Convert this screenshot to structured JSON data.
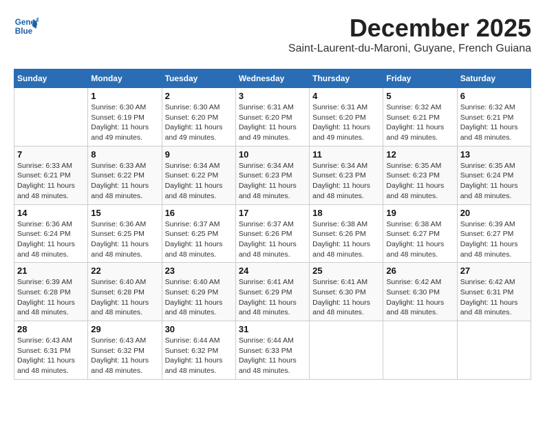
{
  "header": {
    "logo_line1": "General",
    "logo_line2": "Blue",
    "month_title": "December 2025",
    "location": "Saint-Laurent-du-Maroni, Guyane, French Guiana"
  },
  "weekdays": [
    "Sunday",
    "Monday",
    "Tuesday",
    "Wednesday",
    "Thursday",
    "Friday",
    "Saturday"
  ],
  "weeks": [
    [
      {
        "day": "",
        "sunrise": "",
        "sunset": "",
        "daylight": ""
      },
      {
        "day": "1",
        "sunrise": "Sunrise: 6:30 AM",
        "sunset": "Sunset: 6:19 PM",
        "daylight": "Daylight: 11 hours and 49 minutes."
      },
      {
        "day": "2",
        "sunrise": "Sunrise: 6:30 AM",
        "sunset": "Sunset: 6:20 PM",
        "daylight": "Daylight: 11 hours and 49 minutes."
      },
      {
        "day": "3",
        "sunrise": "Sunrise: 6:31 AM",
        "sunset": "Sunset: 6:20 PM",
        "daylight": "Daylight: 11 hours and 49 minutes."
      },
      {
        "day": "4",
        "sunrise": "Sunrise: 6:31 AM",
        "sunset": "Sunset: 6:20 PM",
        "daylight": "Daylight: 11 hours and 49 minutes."
      },
      {
        "day": "5",
        "sunrise": "Sunrise: 6:32 AM",
        "sunset": "Sunset: 6:21 PM",
        "daylight": "Daylight: 11 hours and 49 minutes."
      },
      {
        "day": "6",
        "sunrise": "Sunrise: 6:32 AM",
        "sunset": "Sunset: 6:21 PM",
        "daylight": "Daylight: 11 hours and 48 minutes."
      }
    ],
    [
      {
        "day": "7",
        "sunrise": "Sunrise: 6:33 AM",
        "sunset": "Sunset: 6:21 PM",
        "daylight": "Daylight: 11 hours and 48 minutes."
      },
      {
        "day": "8",
        "sunrise": "Sunrise: 6:33 AM",
        "sunset": "Sunset: 6:22 PM",
        "daylight": "Daylight: 11 hours and 48 minutes."
      },
      {
        "day": "9",
        "sunrise": "Sunrise: 6:34 AM",
        "sunset": "Sunset: 6:22 PM",
        "daylight": "Daylight: 11 hours and 48 minutes."
      },
      {
        "day": "10",
        "sunrise": "Sunrise: 6:34 AM",
        "sunset": "Sunset: 6:23 PM",
        "daylight": "Daylight: 11 hours and 48 minutes."
      },
      {
        "day": "11",
        "sunrise": "Sunrise: 6:34 AM",
        "sunset": "Sunset: 6:23 PM",
        "daylight": "Daylight: 11 hours and 48 minutes."
      },
      {
        "day": "12",
        "sunrise": "Sunrise: 6:35 AM",
        "sunset": "Sunset: 6:23 PM",
        "daylight": "Daylight: 11 hours and 48 minutes."
      },
      {
        "day": "13",
        "sunrise": "Sunrise: 6:35 AM",
        "sunset": "Sunset: 6:24 PM",
        "daylight": "Daylight: 11 hours and 48 minutes."
      }
    ],
    [
      {
        "day": "14",
        "sunrise": "Sunrise: 6:36 AM",
        "sunset": "Sunset: 6:24 PM",
        "daylight": "Daylight: 11 hours and 48 minutes."
      },
      {
        "day": "15",
        "sunrise": "Sunrise: 6:36 AM",
        "sunset": "Sunset: 6:25 PM",
        "daylight": "Daylight: 11 hours and 48 minutes."
      },
      {
        "day": "16",
        "sunrise": "Sunrise: 6:37 AM",
        "sunset": "Sunset: 6:25 PM",
        "daylight": "Daylight: 11 hours and 48 minutes."
      },
      {
        "day": "17",
        "sunrise": "Sunrise: 6:37 AM",
        "sunset": "Sunset: 6:26 PM",
        "daylight": "Daylight: 11 hours and 48 minutes."
      },
      {
        "day": "18",
        "sunrise": "Sunrise: 6:38 AM",
        "sunset": "Sunset: 6:26 PM",
        "daylight": "Daylight: 11 hours and 48 minutes."
      },
      {
        "day": "19",
        "sunrise": "Sunrise: 6:38 AM",
        "sunset": "Sunset: 6:27 PM",
        "daylight": "Daylight: 11 hours and 48 minutes."
      },
      {
        "day": "20",
        "sunrise": "Sunrise: 6:39 AM",
        "sunset": "Sunset: 6:27 PM",
        "daylight": "Daylight: 11 hours and 48 minutes."
      }
    ],
    [
      {
        "day": "21",
        "sunrise": "Sunrise: 6:39 AM",
        "sunset": "Sunset: 6:28 PM",
        "daylight": "Daylight: 11 hours and 48 minutes."
      },
      {
        "day": "22",
        "sunrise": "Sunrise: 6:40 AM",
        "sunset": "Sunset: 6:28 PM",
        "daylight": "Daylight: 11 hours and 48 minutes."
      },
      {
        "day": "23",
        "sunrise": "Sunrise: 6:40 AM",
        "sunset": "Sunset: 6:29 PM",
        "daylight": "Daylight: 11 hours and 48 minutes."
      },
      {
        "day": "24",
        "sunrise": "Sunrise: 6:41 AM",
        "sunset": "Sunset: 6:29 PM",
        "daylight": "Daylight: 11 hours and 48 minutes."
      },
      {
        "day": "25",
        "sunrise": "Sunrise: 6:41 AM",
        "sunset": "Sunset: 6:30 PM",
        "daylight": "Daylight: 11 hours and 48 minutes."
      },
      {
        "day": "26",
        "sunrise": "Sunrise: 6:42 AM",
        "sunset": "Sunset: 6:30 PM",
        "daylight": "Daylight: 11 hours and 48 minutes."
      },
      {
        "day": "27",
        "sunrise": "Sunrise: 6:42 AM",
        "sunset": "Sunset: 6:31 PM",
        "daylight": "Daylight: 11 hours and 48 minutes."
      }
    ],
    [
      {
        "day": "28",
        "sunrise": "Sunrise: 6:43 AM",
        "sunset": "Sunset: 6:31 PM",
        "daylight": "Daylight: 11 hours and 48 minutes."
      },
      {
        "day": "29",
        "sunrise": "Sunrise: 6:43 AM",
        "sunset": "Sunset: 6:32 PM",
        "daylight": "Daylight: 11 hours and 48 minutes."
      },
      {
        "day": "30",
        "sunrise": "Sunrise: 6:44 AM",
        "sunset": "Sunset: 6:32 PM",
        "daylight": "Daylight: 11 hours and 48 minutes."
      },
      {
        "day": "31",
        "sunrise": "Sunrise: 6:44 AM",
        "sunset": "Sunset: 6:33 PM",
        "daylight": "Daylight: 11 hours and 48 minutes."
      },
      {
        "day": "",
        "sunrise": "",
        "sunset": "",
        "daylight": ""
      },
      {
        "day": "",
        "sunrise": "",
        "sunset": "",
        "daylight": ""
      },
      {
        "day": "",
        "sunrise": "",
        "sunset": "",
        "daylight": ""
      }
    ]
  ]
}
